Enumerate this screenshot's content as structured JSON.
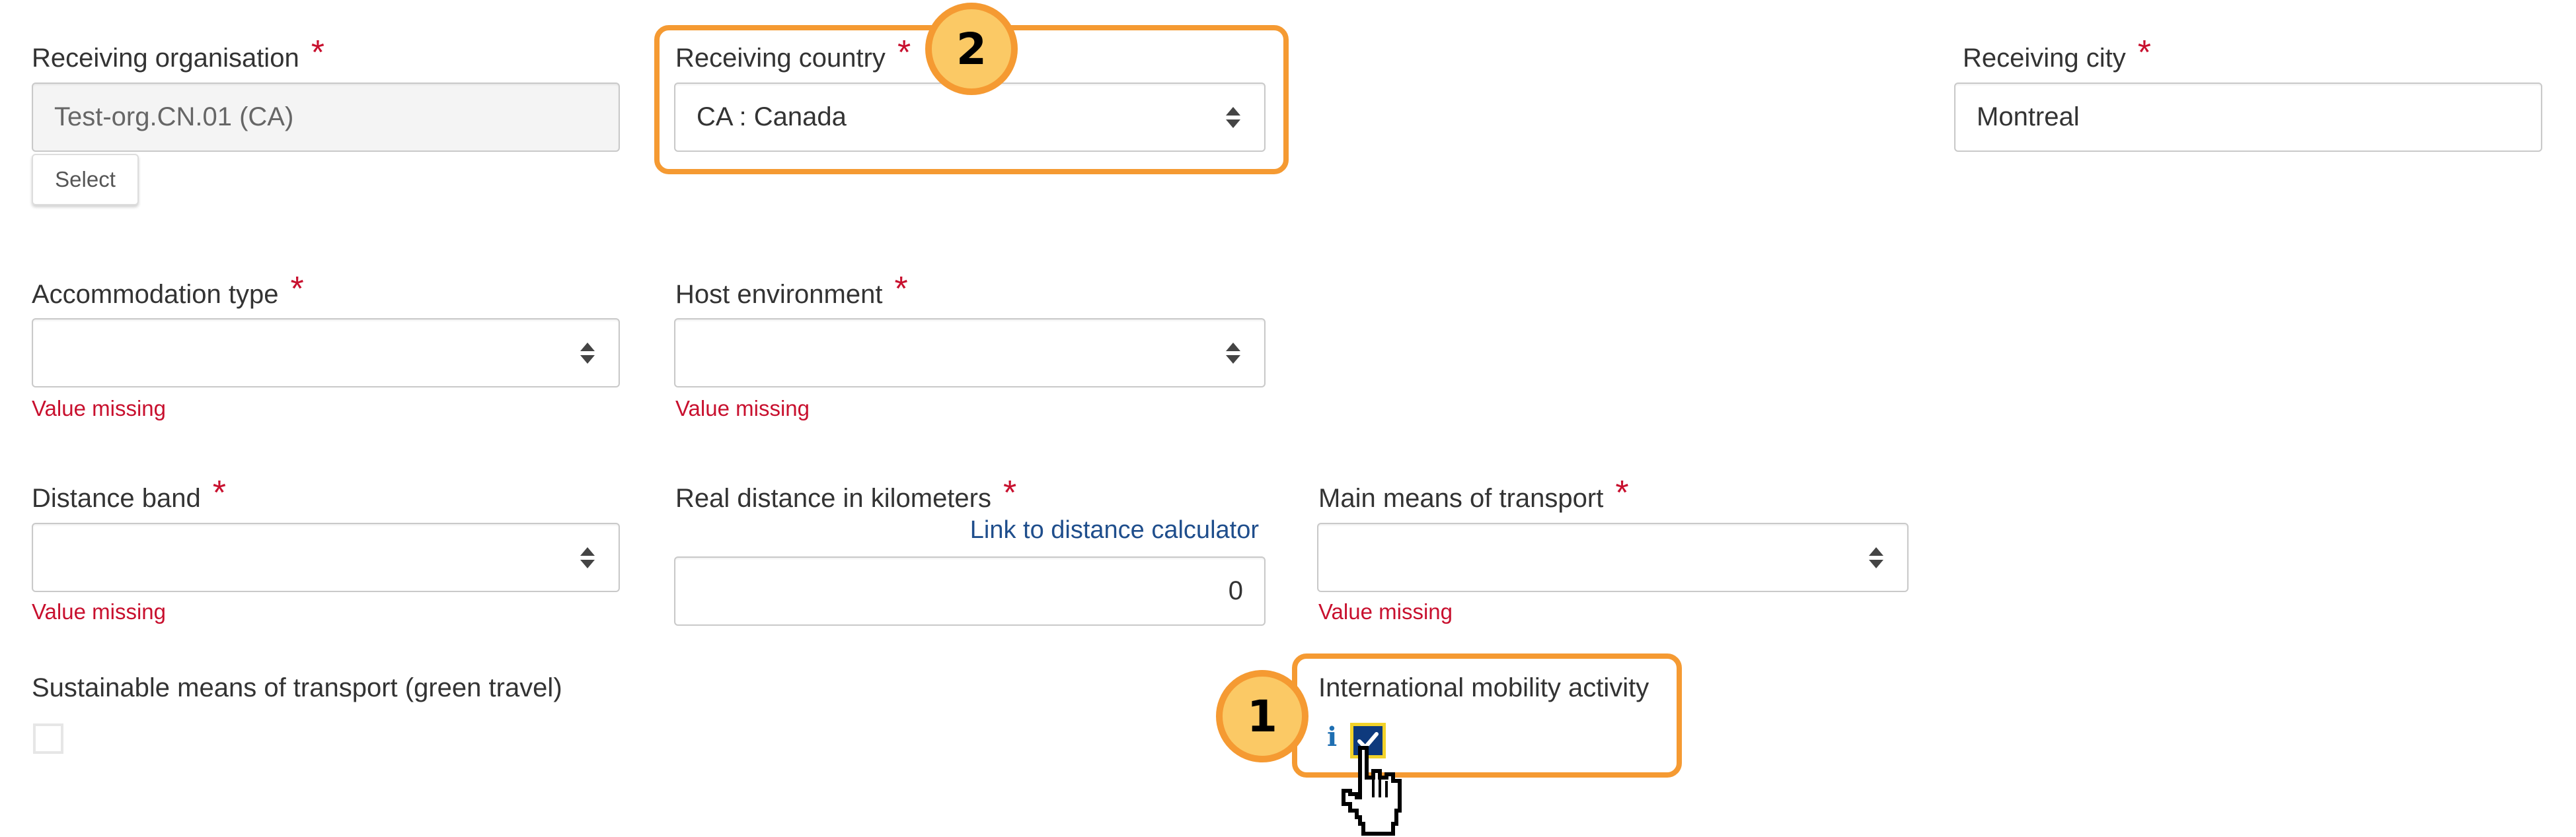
{
  "form": {
    "receiving_organisation": {
      "label": "Receiving organisation",
      "required_mark": "*",
      "value": "Test-org.CN.01 (CA)",
      "select_button_label": "Select"
    },
    "receiving_country": {
      "label": "Receiving country",
      "required_mark": "*",
      "value": "CA : Canada"
    },
    "receiving_city": {
      "label": "Receiving city",
      "required_mark": "*",
      "value": "Montreal"
    },
    "accommodation_type": {
      "label": "Accommodation type",
      "required_mark": "*",
      "value": "",
      "error": "Value missing"
    },
    "host_environment": {
      "label": "Host environment",
      "required_mark": "*",
      "value": "",
      "error": "Value missing"
    },
    "distance_band": {
      "label": "Distance band",
      "required_mark": "*",
      "value": "",
      "error": "Value missing"
    },
    "real_distance": {
      "label": "Real distance in kilometers",
      "required_mark": "*",
      "link_label": "Link to distance calculator",
      "value": "0"
    },
    "main_transport": {
      "label": "Main means of transport",
      "required_mark": "*",
      "value": "",
      "error": "Value missing"
    },
    "green_travel": {
      "label": "Sustainable means of transport (green travel)",
      "checked": false
    },
    "international_mobility": {
      "label": "International mobility activity",
      "info_icon": "i",
      "checked": true
    }
  },
  "annotations": {
    "step_1": "1",
    "step_2": "2",
    "highlight_color": "#f59a32",
    "badge_fill": "#fbc965"
  },
  "colors": {
    "required": "#c8102e",
    "error": "#c8102e",
    "link": "#1f4e8c",
    "checkbox_checked": "#0e3a7d"
  }
}
